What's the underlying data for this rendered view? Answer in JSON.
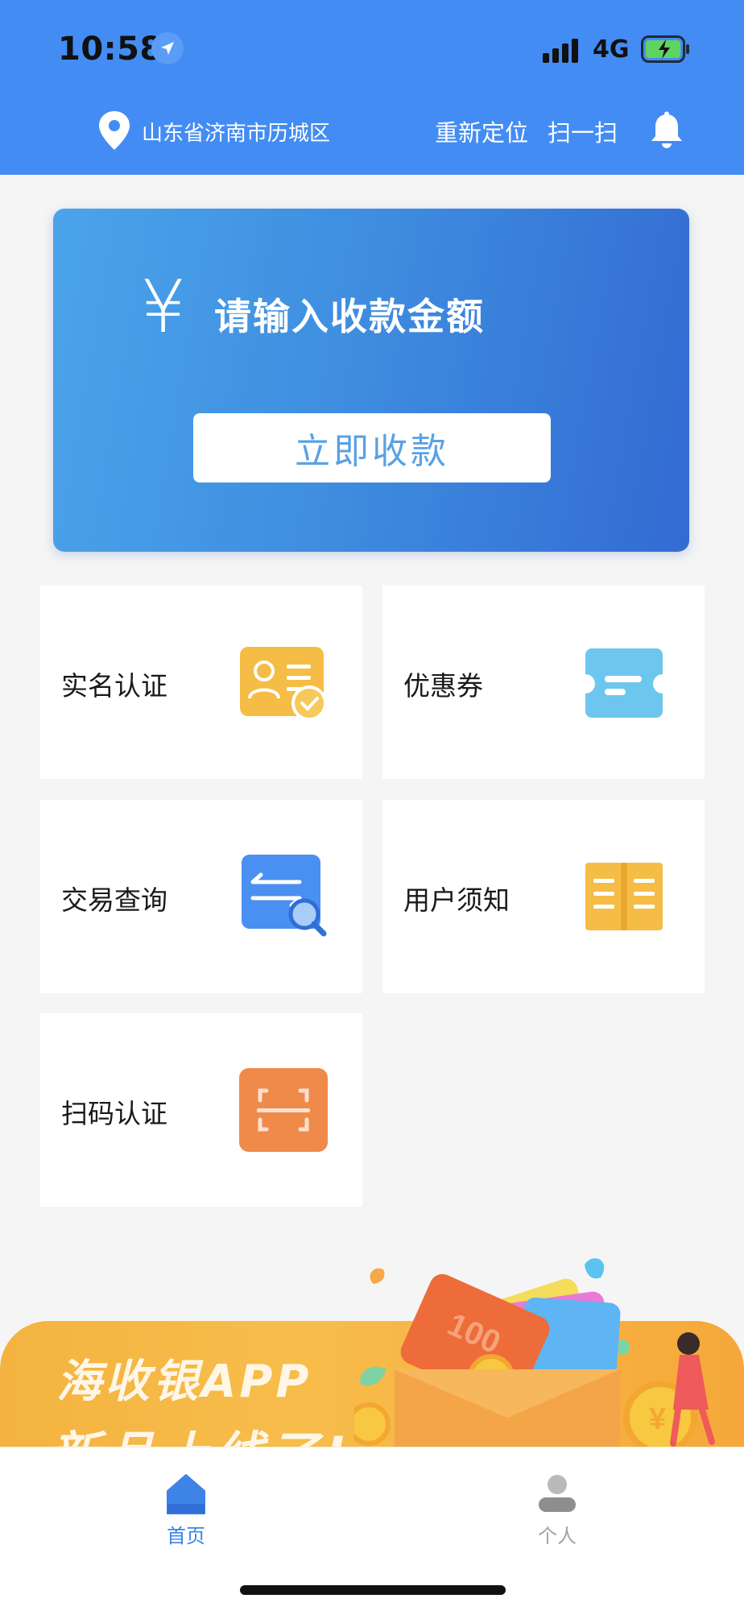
{
  "status_bar": {
    "time": "10:58",
    "network": "4G"
  },
  "header": {
    "location": "山东省济南市历城区",
    "relocate": "重新定位",
    "scan": "扫一扫"
  },
  "payment_card": {
    "currency_symbol": "¥",
    "amount_hint": "请输入收款金额",
    "pay_button": "立即收款"
  },
  "menu": [
    {
      "label": "实名认证",
      "icon": "id-card-verify-icon"
    },
    {
      "label": "优惠券",
      "icon": "coupon-icon"
    },
    {
      "label": "交易查询",
      "icon": "transaction-search-icon"
    },
    {
      "label": "用户须知",
      "icon": "book-icon"
    },
    {
      "label": "扫码认证",
      "icon": "scan-code-icon"
    }
  ],
  "banner": {
    "line1": "海收银APP",
    "line2": "新品上线了!",
    "ticket_text": "100"
  },
  "bottom_nav": [
    {
      "label": "首页",
      "icon": "home-icon",
      "active": true
    },
    {
      "label": "个人",
      "icon": "person-icon",
      "active": false
    }
  ],
  "colors": {
    "header_bg": "#438cf4",
    "card_gradient_start": "#4ba4ea",
    "card_gradient_end": "#336bd3",
    "active_nav": "#3d83e8",
    "inactive_nav": "#a3a3a3"
  }
}
